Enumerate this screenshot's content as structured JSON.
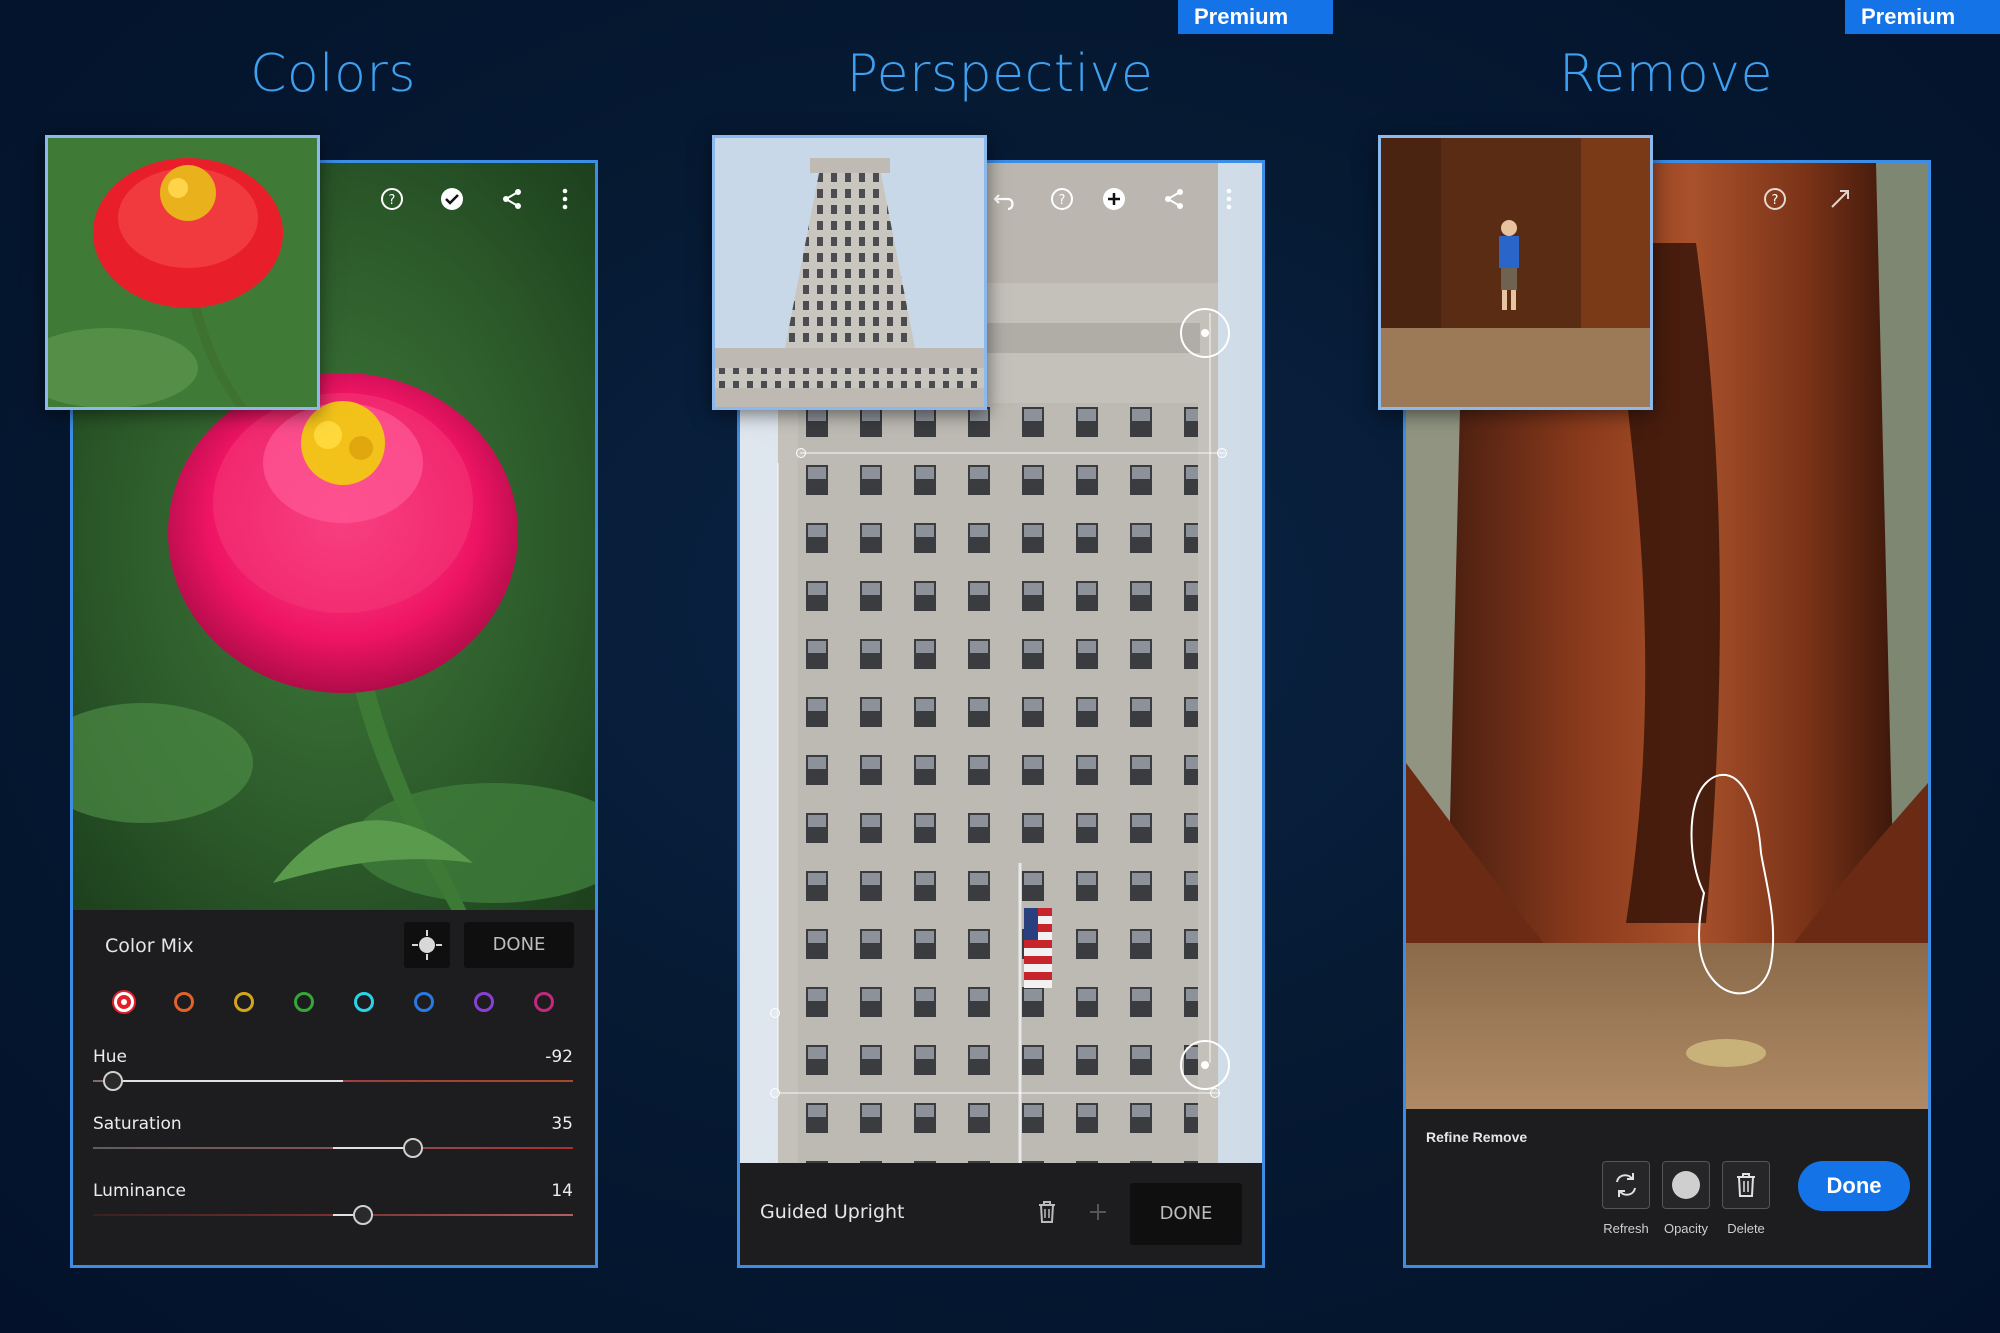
{
  "panels": {
    "colors": {
      "title": "Colors"
    },
    "perspective": {
      "title": "Perspective",
      "badge": "Premium"
    },
    "remove": {
      "title": "Remove",
      "badge": "Premium"
    }
  },
  "colors_panel": {
    "toolbar_icons": [
      "help-icon",
      "checkmark-icon",
      "share-icon",
      "more-icon"
    ],
    "bar_title": "Color Mix",
    "done_label": "DONE",
    "swatches": [
      {
        "name": "red",
        "color": "#e0212a",
        "selected": true
      },
      {
        "name": "orange",
        "color": "#e0612a"
      },
      {
        "name": "yellow",
        "color": "#d4a51c"
      },
      {
        "name": "green",
        "color": "#34a835"
      },
      {
        "name": "aqua",
        "color": "#29d3e8"
      },
      {
        "name": "blue",
        "color": "#2a79e0"
      },
      {
        "name": "purple",
        "color": "#8a3fd4"
      },
      {
        "name": "magenta",
        "color": "#c2297c"
      }
    ],
    "sliders": [
      {
        "label": "Hue",
        "value": "-92"
      },
      {
        "label": "Saturation",
        "value": "35"
      },
      {
        "label": "Luminance",
        "value": "14"
      }
    ]
  },
  "perspective_panel": {
    "toolbar_icons": [
      "undo-icon",
      "help-icon",
      "add-icon",
      "share-icon",
      "more-icon"
    ],
    "bar_title": "Guided Upright",
    "done_label": "DONE"
  },
  "remove_panel": {
    "toolbar_icons": [
      "help-icon",
      "expand-icon"
    ],
    "bar_title": "Refine Remove",
    "tools": [
      {
        "label": "Refresh"
      },
      {
        "label": "Opacity"
      },
      {
        "label": "Delete"
      }
    ],
    "done_label": "Done"
  },
  "colors": {
    "accent": "#3ea0f0",
    "badge": "#1473e6",
    "frame": "#3b8de6"
  }
}
